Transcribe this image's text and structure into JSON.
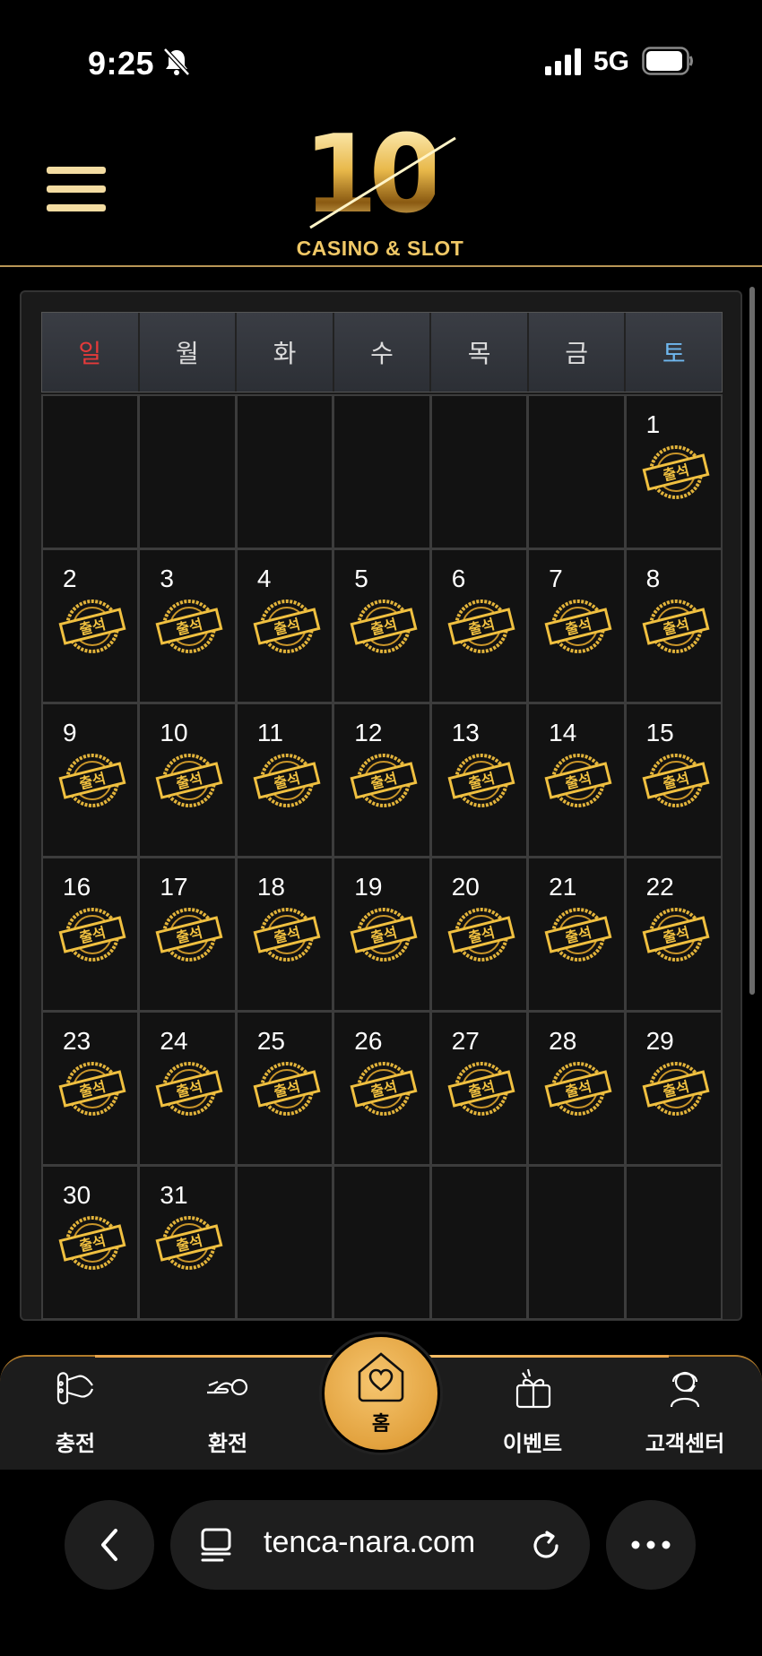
{
  "status_bar": {
    "time": "9:25",
    "network": "5G"
  },
  "header": {
    "logo_number": "10",
    "logo_subtitle": "CASINO & SLOT"
  },
  "calendar": {
    "weekdays": [
      "일",
      "월",
      "화",
      "수",
      "목",
      "금",
      "토"
    ],
    "leading_blank_days": 6,
    "days": [
      "1",
      "2",
      "3",
      "4",
      "5",
      "6",
      "7",
      "8",
      "9",
      "10",
      "11",
      "12",
      "13",
      "14",
      "15",
      "16",
      "17",
      "18",
      "19",
      "20",
      "21",
      "22",
      "23",
      "24",
      "25",
      "26",
      "27",
      "28",
      "29",
      "30",
      "31"
    ],
    "stamp_text": "출석",
    "stamped_days": 31
  },
  "bottom_nav": {
    "items": [
      {
        "label": "충전",
        "icon": "charge-icon"
      },
      {
        "label": "환전",
        "icon": "exchange-icon"
      },
      {
        "label": "홈",
        "icon": "home-heart-icon"
      },
      {
        "label": "이벤트",
        "icon": "gift-icon"
      },
      {
        "label": "고객센터",
        "icon": "support-icon"
      }
    ]
  },
  "browser": {
    "url": "tenca-nara.com"
  },
  "colors": {
    "gold": "#e2a23e",
    "sunday": "#e53a3a",
    "saturday": "#6fb7ee",
    "background": "#000000"
  }
}
